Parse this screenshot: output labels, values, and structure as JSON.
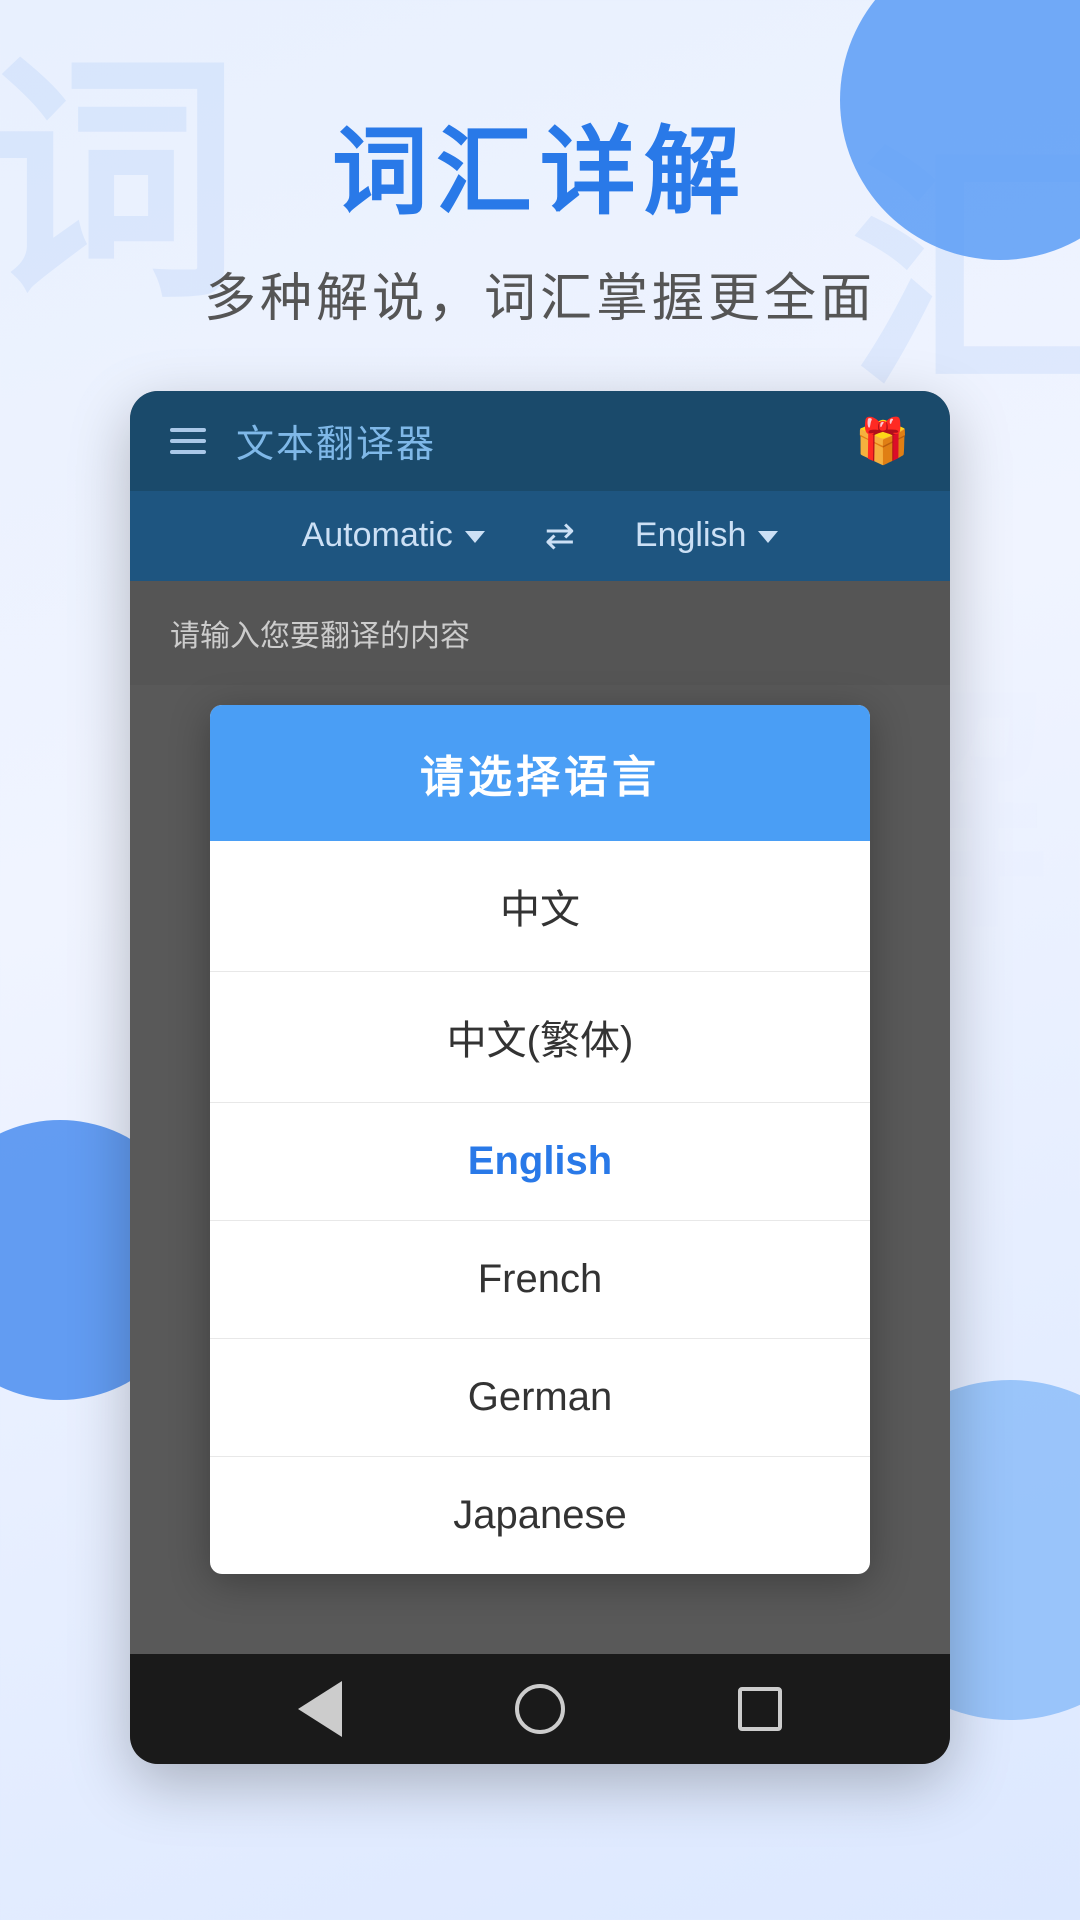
{
  "background": {
    "watermark1": "词",
    "watermark2": "汇",
    "watermark3": "解"
  },
  "header": {
    "main_title": "词汇详解",
    "sub_title": "多种解说，词汇掌握更全面"
  },
  "app": {
    "topbar": {
      "app_name": "文本翻译器",
      "gift_emoji": "🎁"
    },
    "lang_bar": {
      "source_lang": "Automatic",
      "target_lang": "English"
    },
    "input_placeholder": "请输入您要翻译的内容"
  },
  "dialog": {
    "title": "请选择语言",
    "languages": [
      {
        "label": "中文",
        "selected": false
      },
      {
        "label": "中文(繁体)",
        "selected": false
      },
      {
        "label": "English",
        "selected": true
      },
      {
        "label": "French",
        "selected": false
      },
      {
        "label": "German",
        "selected": false
      },
      {
        "label": "Japanese",
        "selected": false
      }
    ]
  },
  "bottom_nav": {
    "back_label": "back",
    "home_label": "home",
    "recents_label": "recents"
  }
}
